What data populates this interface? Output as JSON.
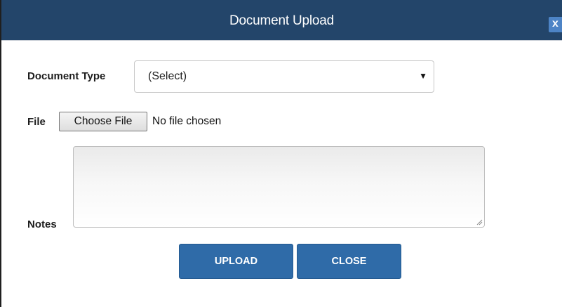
{
  "dialog": {
    "title": "Document Upload",
    "close_label": "x"
  },
  "form": {
    "document_type_label": "Document Type",
    "document_type_value": "(Select)",
    "file_label": "File",
    "file_button_label": "Choose File",
    "file_status": "No file chosen",
    "notes_label": "Notes",
    "notes_value": ""
  },
  "actions": {
    "upload_label": "UPLOAD",
    "close_label": "CLOSE"
  },
  "colors": {
    "titlebar": "#23456a",
    "button": "#2f6ba8",
    "close_icon_bg": "#4d84c6"
  },
  "icons": {
    "select_arrow": "caret-down-icon",
    "resize": "resize-grip-icon"
  }
}
